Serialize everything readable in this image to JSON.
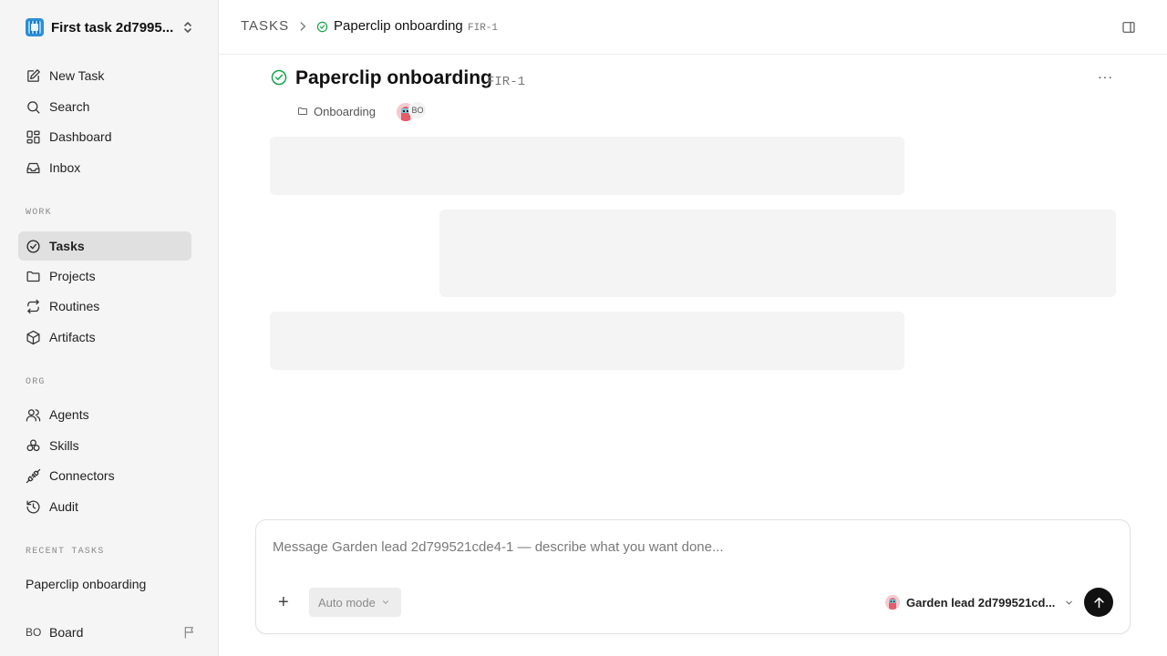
{
  "workspace": {
    "name": "First task 2d7995..."
  },
  "nav_main": [
    {
      "label": "New Task",
      "icon": "edit-icon"
    },
    {
      "label": "Search",
      "icon": "search-icon"
    },
    {
      "label": "Dashboard",
      "icon": "dashboard-icon"
    },
    {
      "label": "Inbox",
      "icon": "inbox-icon"
    }
  ],
  "sections": {
    "work": "WORK",
    "org": "ORG",
    "recent": "RECENT TASKS"
  },
  "nav_work": [
    {
      "label": "Tasks",
      "icon": "check-circle-icon",
      "active": true
    },
    {
      "label": "Projects",
      "icon": "folder-icon"
    },
    {
      "label": "Routines",
      "icon": "repeat-icon"
    },
    {
      "label": "Artifacts",
      "icon": "box-icon"
    }
  ],
  "nav_org": [
    {
      "label": "Agents",
      "icon": "users-icon"
    },
    {
      "label": "Skills",
      "icon": "skills-icon"
    },
    {
      "label": "Connectors",
      "icon": "plug-icon"
    },
    {
      "label": "Audit",
      "icon": "history-icon"
    }
  ],
  "recent_tasks": [
    "Paperclip onboarding"
  ],
  "board": {
    "initials": "BO",
    "name": "Board"
  },
  "breadcrumb": {
    "root": "TASKS",
    "title": "Paperclip onboarding",
    "id": "FIR-1"
  },
  "task": {
    "title": "Paperclip onboarding",
    "id": "FIR-1",
    "project": "Onboarding",
    "assignee_initials": "BO",
    "more": "···"
  },
  "composer": {
    "placeholder": "Message Garden lead 2d799521cde4-1 — describe what you want done...",
    "add": "+",
    "mode": "Auto mode",
    "agent": "Garden lead 2d799521cd..."
  },
  "colors": {
    "accent_green": "#16a34a",
    "sidebar_bg": "#f5f5f5",
    "send_bg": "#111111"
  }
}
